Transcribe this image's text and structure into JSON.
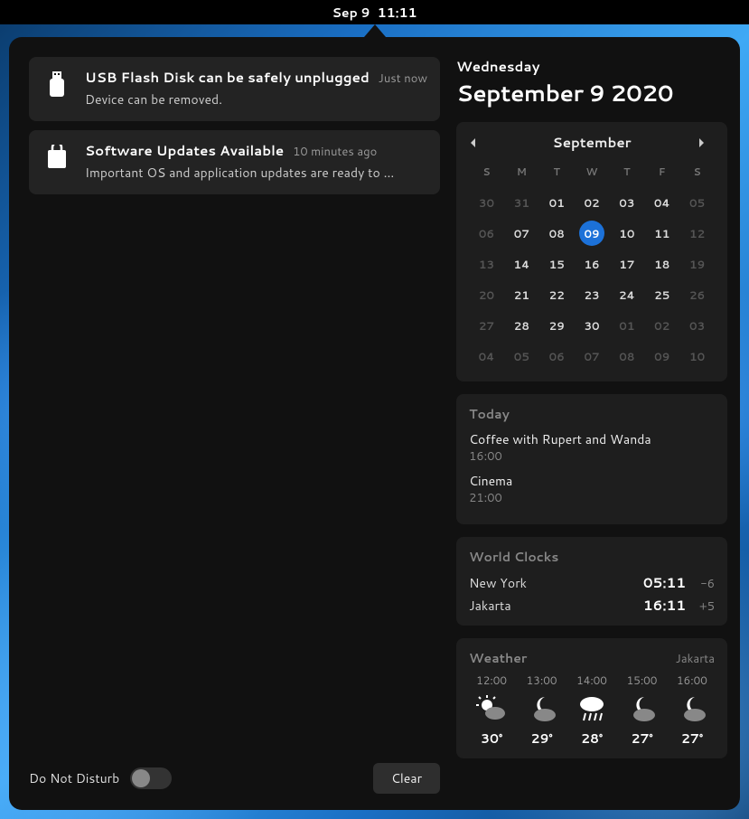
{
  "topbar": {
    "date": "Sep 9",
    "time": "11:11"
  },
  "notifications": [
    {
      "icon": "usb-icon",
      "title": "USB Flash Disk can be safely unplugged",
      "timestamp": "Just now",
      "message": "Device can be removed."
    },
    {
      "icon": "package-icon",
      "title": "Software Updates Available",
      "timestamp": "10 minutes ago",
      "message": "Important OS and application updates are ready to …"
    }
  ],
  "dnd": {
    "label": "Do Not Disturb",
    "on": false
  },
  "clear_label": "Clear",
  "date_header": {
    "dow": "Wednesday",
    "full": "September 9 2020"
  },
  "calendar": {
    "month": "September",
    "dow": [
      "S",
      "M",
      "T",
      "W",
      "T",
      "F",
      "S"
    ],
    "weeks": [
      [
        {
          "n": "30",
          "dim": true
        },
        {
          "n": "31",
          "dim": true
        },
        {
          "n": "01"
        },
        {
          "n": "02"
        },
        {
          "n": "03"
        },
        {
          "n": "04"
        },
        {
          "n": "05",
          "dim": true
        }
      ],
      [
        {
          "n": "06",
          "dim": true
        },
        {
          "n": "07"
        },
        {
          "n": "08"
        },
        {
          "n": "09",
          "today": true
        },
        {
          "n": "10"
        },
        {
          "n": "11"
        },
        {
          "n": "12",
          "dim": true
        }
      ],
      [
        {
          "n": "13",
          "dim": true
        },
        {
          "n": "14"
        },
        {
          "n": "15"
        },
        {
          "n": "16"
        },
        {
          "n": "17"
        },
        {
          "n": "18"
        },
        {
          "n": "19",
          "dim": true
        }
      ],
      [
        {
          "n": "20",
          "dim": true
        },
        {
          "n": "21"
        },
        {
          "n": "22"
        },
        {
          "n": "23"
        },
        {
          "n": "24"
        },
        {
          "n": "25"
        },
        {
          "n": "26",
          "dim": true
        }
      ],
      [
        {
          "n": "27",
          "dim": true
        },
        {
          "n": "28"
        },
        {
          "n": "29"
        },
        {
          "n": "30"
        },
        {
          "n": "01",
          "dim": true
        },
        {
          "n": "02",
          "dim": true
        },
        {
          "n": "03",
          "dim": true
        }
      ],
      [
        {
          "n": "04",
          "dim": true
        },
        {
          "n": "05",
          "dim": true
        },
        {
          "n": "06",
          "dim": true
        },
        {
          "n": "07",
          "dim": true
        },
        {
          "n": "08",
          "dim": true
        },
        {
          "n": "09",
          "dim": true
        },
        {
          "n": "10",
          "dim": true
        }
      ]
    ]
  },
  "events": {
    "title": "Today",
    "items": [
      {
        "title": "Coffee with Rupert and Wanda",
        "time": "16:00"
      },
      {
        "title": "Cinema",
        "time": "21:00"
      }
    ]
  },
  "world_clocks": {
    "title": "World Clocks",
    "items": [
      {
        "city": "New York",
        "time": "05:11",
        "offset": "-6"
      },
      {
        "city": "Jakarta",
        "time": "16:11",
        "offset": "+5"
      }
    ]
  },
  "weather": {
    "title": "Weather",
    "location": "Jakarta",
    "forecast": [
      {
        "time": "12:00",
        "icon": "sun-cloud",
        "temp": "30°"
      },
      {
        "time": "13:00",
        "icon": "night-cloud",
        "temp": "29°"
      },
      {
        "time": "14:00",
        "icon": "rain",
        "temp": "28°"
      },
      {
        "time": "15:00",
        "icon": "night-cloud",
        "temp": "27°"
      },
      {
        "time": "16:00",
        "icon": "night-cloud",
        "temp": "27°"
      }
    ]
  }
}
